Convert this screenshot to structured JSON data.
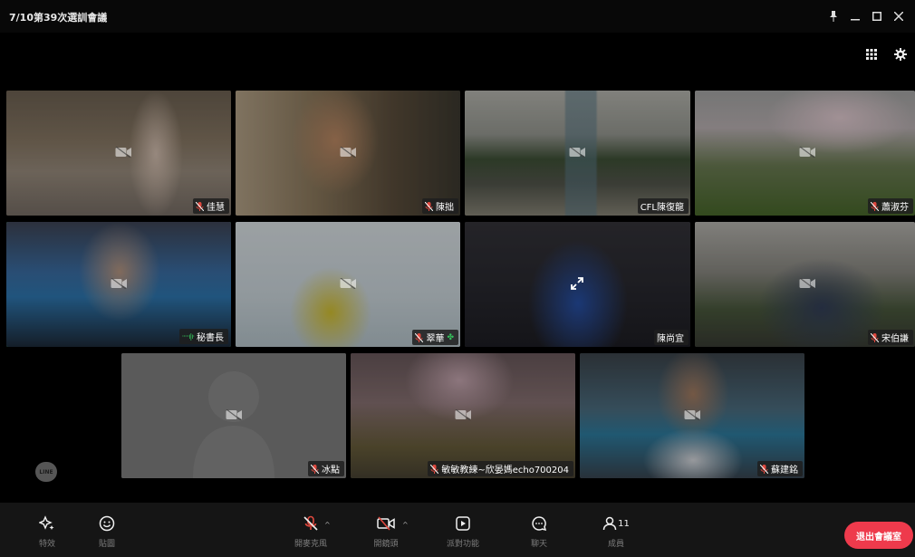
{
  "window": {
    "title": "7/10第39次選訓會議",
    "pin_icon": "pin-icon",
    "minimize_icon": "minimize-icon",
    "maximize_icon": "maximize-icon",
    "close_icon": "close-icon"
  },
  "top_controls": {
    "grid_icon": "grid-view-icon",
    "settings_icon": "gear-icon"
  },
  "participants": [
    {
      "name": "佳慧"
    },
    {
      "name": "陳拙"
    },
    {
      "name": "CFL陳復龍"
    },
    {
      "name": "蕭淑芬"
    },
    {
      "name": "秘書長"
    },
    {
      "name": "翠華"
    },
    {
      "name": "陳尚宜"
    },
    {
      "name": "宋伯謙"
    },
    {
      "name": "冰點"
    },
    {
      "name": "敏敏教練~欣晏媽echo700204"
    },
    {
      "name": "蘇建銘"
    }
  ],
  "toolbar": {
    "effects": "特效",
    "stickers": "貼圖",
    "mic": "開麥克風",
    "camera": "開鏡頭",
    "party": "派對功能",
    "chat": "聊天",
    "members": "成員",
    "member_count": "11",
    "leave": "退出會議室"
  },
  "branding": {
    "logo_text": "LINE"
  },
  "colors": {
    "active_speaker": "#35c35c",
    "leave_button": "#ee3a4c",
    "muted": "#e0483e"
  }
}
